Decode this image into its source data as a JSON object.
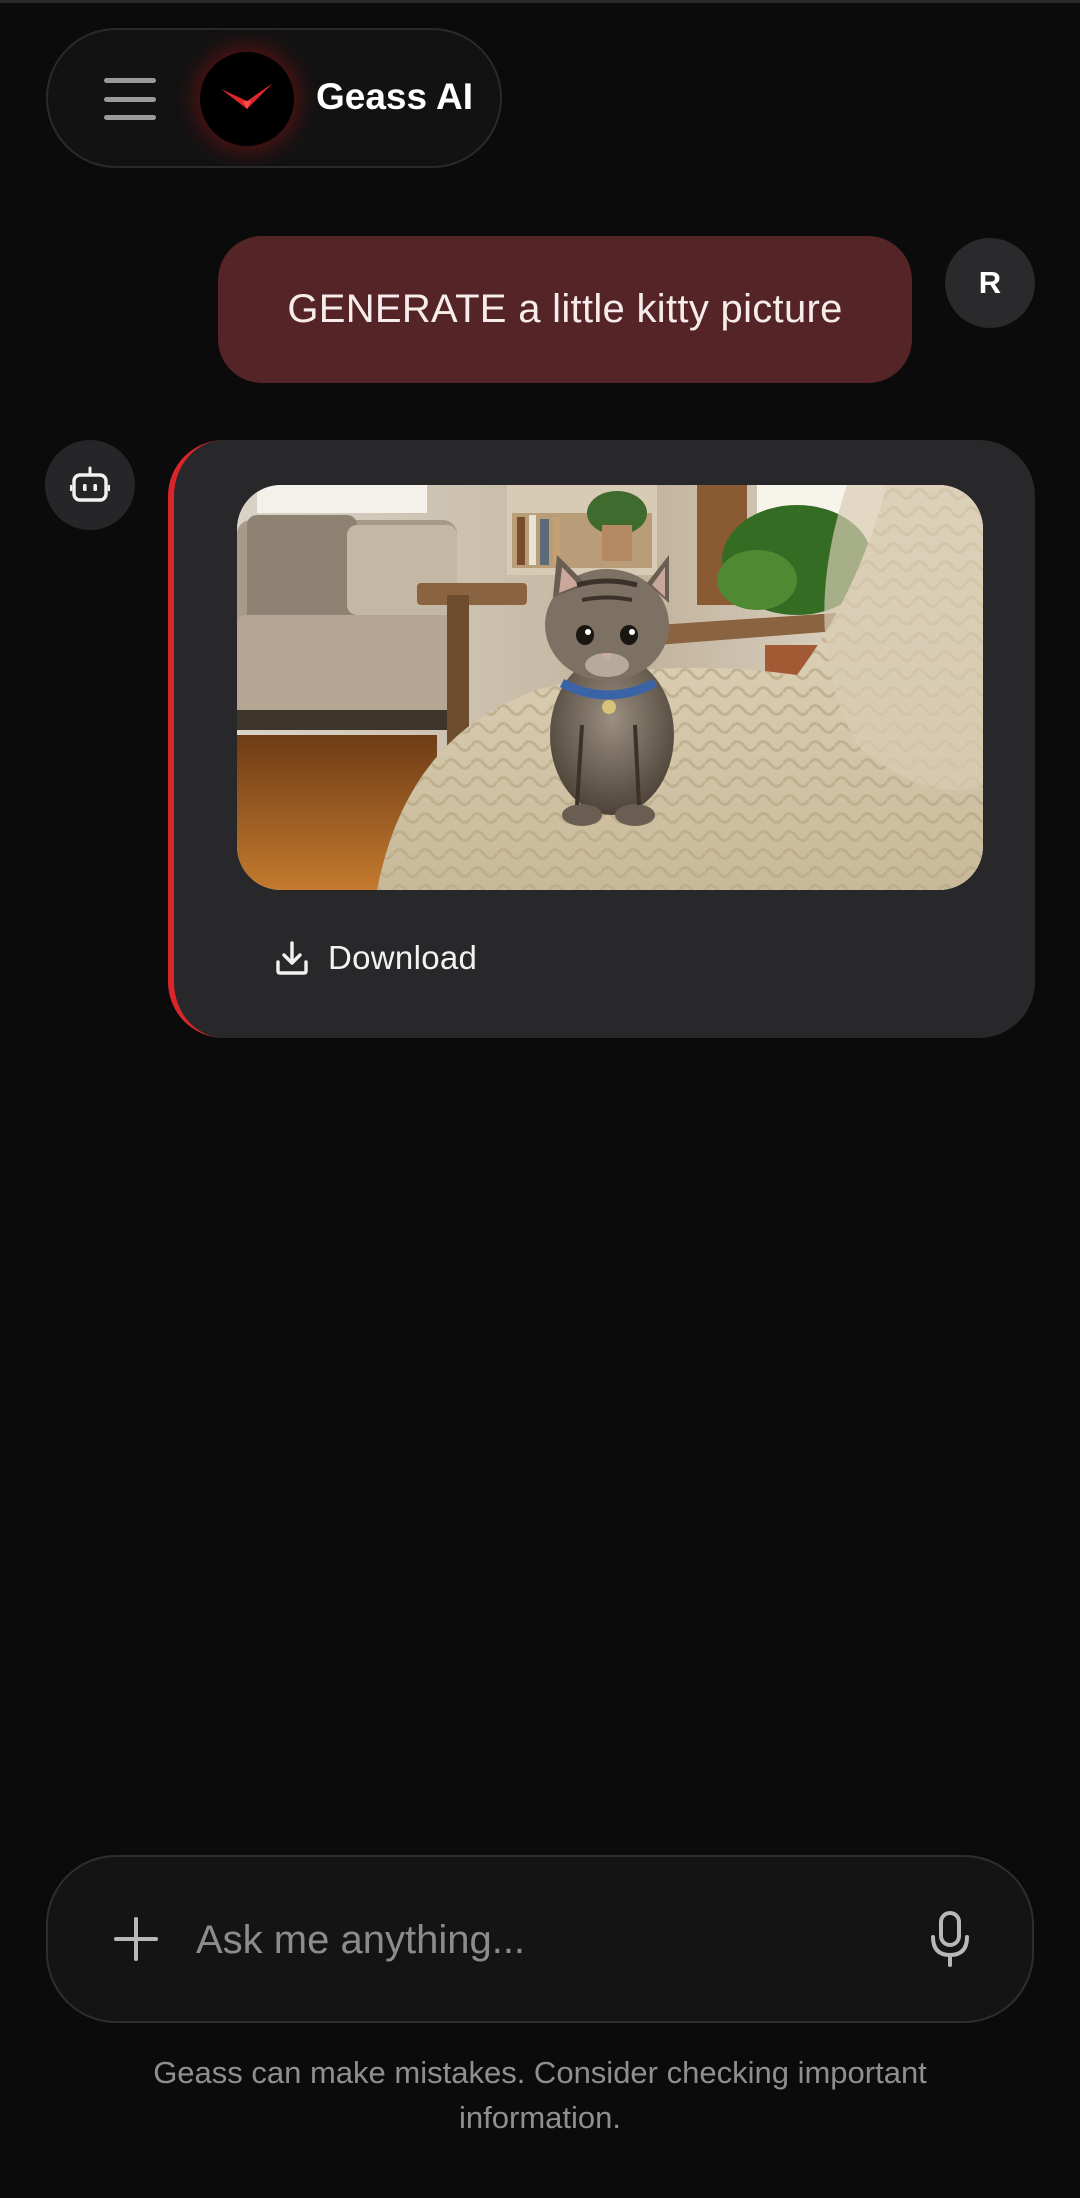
{
  "header": {
    "app_title": "Geass AI",
    "menu_icon": "hamburger-menu-icon",
    "logo_icon": "geass-logo-icon",
    "accent_color": "#d8262b"
  },
  "conversation": {
    "user_message": {
      "text": "GENERATE a little kitty picture",
      "avatar_initial": "R",
      "bubble_color": "#552426"
    },
    "bot_message": {
      "avatar_icon": "robot-icon",
      "image_alt": "generated kitten image",
      "download_label": "Download",
      "download_icon": "download-icon"
    }
  },
  "composer": {
    "placeholder": "Ask me anything...",
    "add_icon": "plus-icon",
    "mic_icon": "microphone-icon"
  },
  "footer": {
    "disclaimer": "Geass can make mistakes. Consider checking important information."
  }
}
